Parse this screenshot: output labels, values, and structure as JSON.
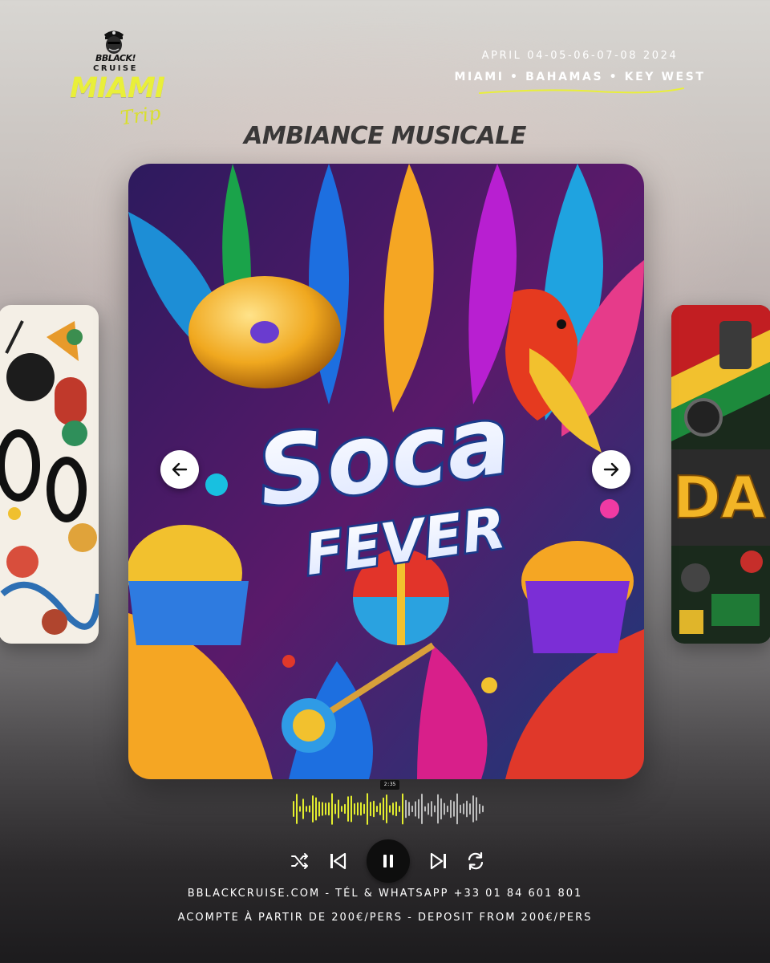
{
  "brand": {
    "name": "BBLACK!",
    "sub": "CRUISE",
    "trip_title": "MIAMI",
    "trip_sub": "Trip"
  },
  "header": {
    "dates": "APRIL 04-05-06-07-08 2024",
    "destinations": "MIAMI • BAHAMAS • KEY WEST"
  },
  "section_title": "AMBIANCE MUSICALE",
  "carousel": {
    "current": {
      "title_line1": "Soca",
      "title_line2": "FEVER"
    }
  },
  "player": {
    "time": "2:35",
    "progress": 0.57
  },
  "icons": {
    "prev": "arrow-left-icon",
    "next": "arrow-right-icon",
    "shuffle": "shuffle-icon",
    "skip_back": "skip-previous-icon",
    "pause": "pause-icon",
    "skip_fwd": "skip-next-icon",
    "repeat": "repeat-icon"
  },
  "colors": {
    "accent": "#e9ef3a",
    "wave_played": "#e4ee2e",
    "wave_remaining": "#bdbdbd"
  },
  "footer": {
    "line1": "BBLACKCRUISE.COM  - TÉL & WHATSAPP +33 01 84 601 801",
    "line2": "ACOMPTE À PARTIR DE 200€/PERS - DEPOSIT FROM 200€/PERS"
  }
}
